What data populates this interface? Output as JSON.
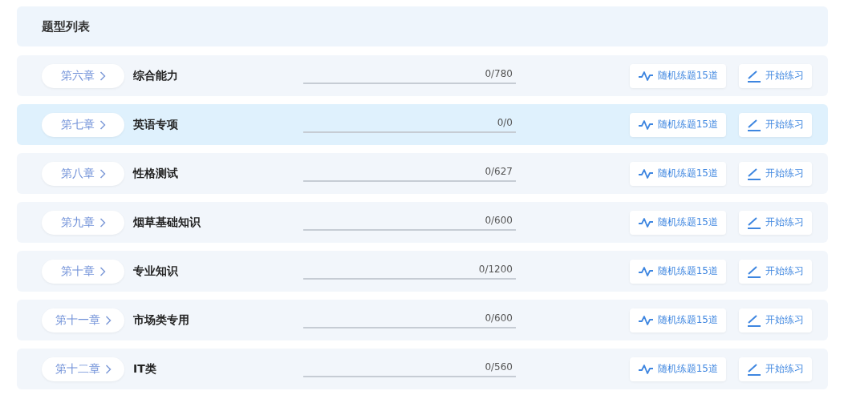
{
  "header": {
    "title": "题型列表"
  },
  "rows": [
    {
      "chapter": "第六章",
      "name": "综合能力",
      "count": "0/780",
      "selected": false,
      "random_button": "随机练题15道",
      "start_button": "开始练习"
    },
    {
      "chapter": "第七章",
      "name": "英语专项",
      "count": "0/0",
      "selected": true,
      "random_button": "随机练题15道",
      "start_button": "开始练习"
    },
    {
      "chapter": "第八章",
      "name": "性格测试",
      "count": "0/627",
      "selected": false,
      "random_button": "随机练题15道",
      "start_button": "开始练习"
    },
    {
      "chapter": "第九章",
      "name": "烟草基础知识",
      "count": "0/600",
      "selected": false,
      "random_button": "随机练题15道",
      "start_button": "开始练习"
    },
    {
      "chapter": "第十章",
      "name": "专业知识",
      "count": "0/1200",
      "selected": false,
      "random_button": "随机练题15道",
      "start_button": "开始练习"
    },
    {
      "chapter": "第十一章",
      "name": "市场类专用",
      "count": "0/600",
      "selected": false,
      "random_button": "随机练题15道",
      "start_button": "开始练习"
    },
    {
      "chapter": "第十二章",
      "name": "IT类",
      "count": "0/560",
      "selected": false,
      "random_button": "随机练题15道",
      "start_button": "开始练习"
    }
  ]
}
